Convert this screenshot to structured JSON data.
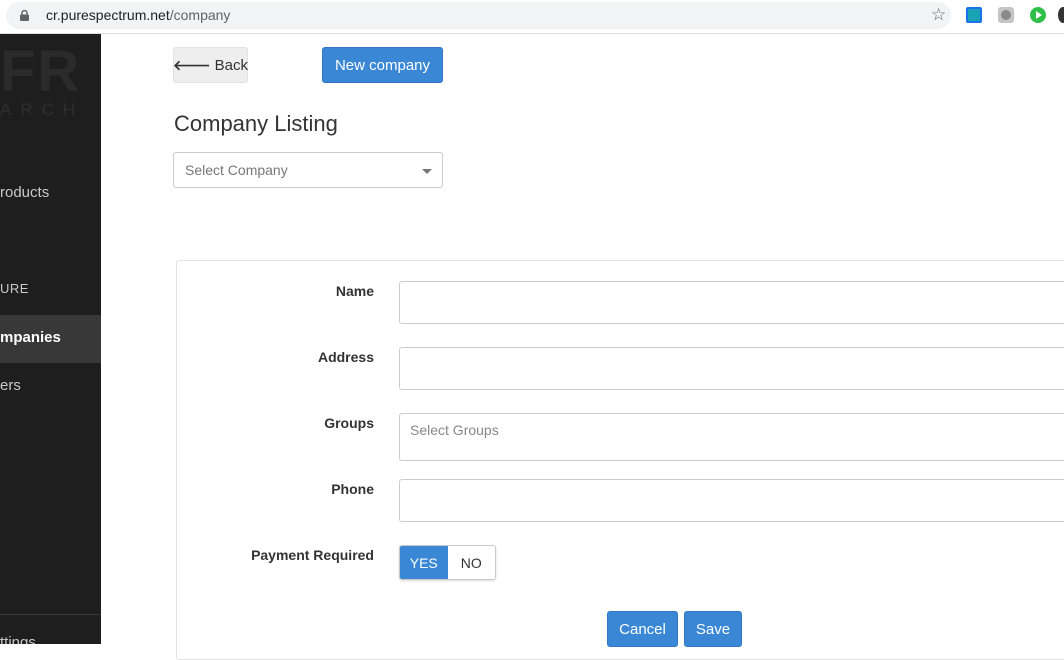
{
  "browser": {
    "url_host": "cr.purespectrum.net",
    "url_path": "/company"
  },
  "sidebar": {
    "logo_big": "FR",
    "logo_small": "ARCH",
    "items": [
      {
        "label": "roducts"
      },
      {
        "label": "URE"
      },
      {
        "label": "mpanies"
      },
      {
        "label": "ers"
      },
      {
        "label": "ttings"
      }
    ]
  },
  "toolbar": {
    "back_label": "Back",
    "new_company_label": "New company"
  },
  "main": {
    "title": "Company Listing",
    "select_company_placeholder": "Select Company"
  },
  "form": {
    "name_label": "Name",
    "name_value": "",
    "address_label": "Address",
    "address_value": "",
    "groups_label": "Groups",
    "groups_placeholder": "Select Groups",
    "phone_label": "Phone",
    "phone_value": "",
    "payment_label": "Payment Required",
    "payment_yes": "YES",
    "payment_no": "NO",
    "payment_selected": "YES",
    "cancel_label": "Cancel",
    "save_label": "Save"
  },
  "colors": {
    "primary": "#3a87d6",
    "sidebar_bg": "#1e1e1e",
    "sidebar_active": "#383838"
  }
}
